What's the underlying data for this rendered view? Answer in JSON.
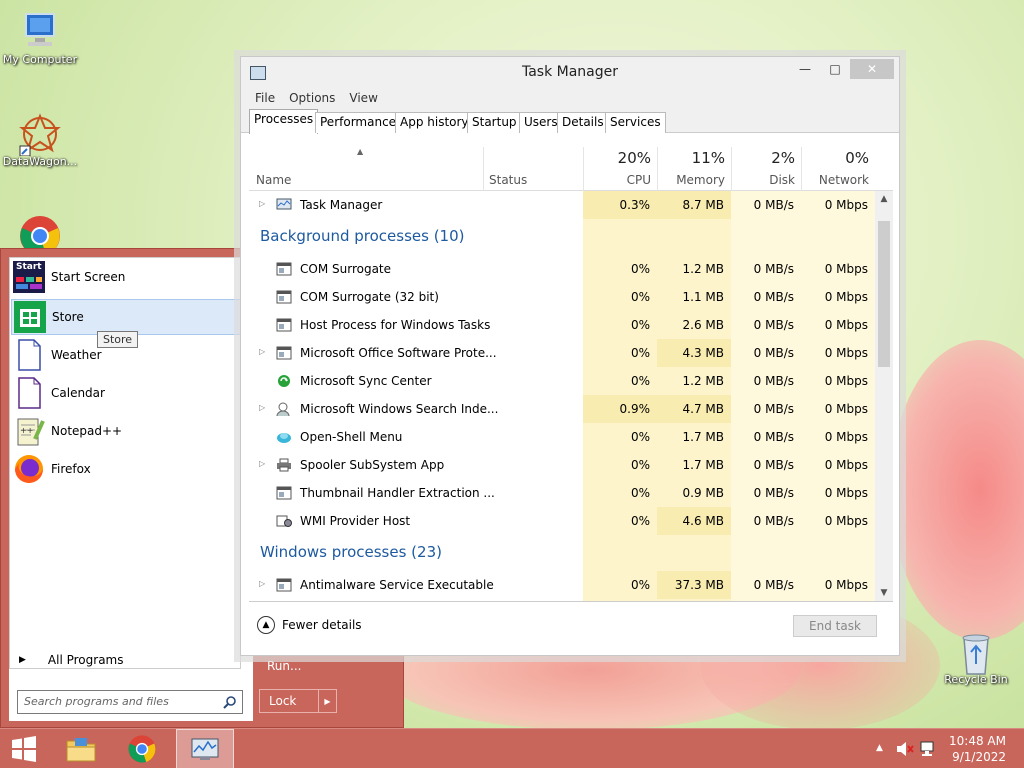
{
  "desktop": {
    "icons": [
      {
        "label": "My Computer"
      },
      {
        "label": "DataWagon..."
      },
      {
        "label": "Recycle Bin"
      }
    ]
  },
  "start_menu": {
    "items": [
      {
        "label": "Start Screen",
        "icon": "start-screen-icon"
      },
      {
        "label": "Store",
        "icon": "store-icon"
      },
      {
        "label": "Weather",
        "icon": "document-icon"
      },
      {
        "label": "Calendar",
        "icon": "document-icon"
      },
      {
        "label": "Notepad++",
        "icon": "notepad-plus-icon"
      },
      {
        "label": "Firefox",
        "icon": "firefox-icon"
      }
    ],
    "start_tile_text": "Start",
    "tooltip": "Store",
    "all_programs": "All Programs",
    "search_placeholder": "Search programs and files",
    "run": "Run...",
    "lock": "Lock"
  },
  "task_manager": {
    "title": "Task Manager",
    "menu": [
      "File",
      "Options",
      "View"
    ],
    "tabs": [
      "Processes",
      "Performance",
      "App history",
      "Startup",
      "Users",
      "Details",
      "Services"
    ],
    "active_tab": "Processes",
    "columns": {
      "name": "Name",
      "status": "Status",
      "cpu": {
        "pct": "20%",
        "label": "CPU"
      },
      "memory": {
        "pct": "11%",
        "label": "Memory"
      },
      "disk": {
        "pct": "2%",
        "label": "Disk"
      },
      "network": {
        "pct": "0%",
        "label": "Network"
      }
    },
    "apps": [
      {
        "name": "Task Manager",
        "cpu": "0.3%",
        "memory": "8.7 MB",
        "disk": "0 MB/s",
        "network": "0 Mbps",
        "expandable": true,
        "icon": "task-manager-icon"
      }
    ],
    "background_group": "Background processes (10)",
    "background": [
      {
        "name": "COM Surrogate",
        "cpu": "0%",
        "memory": "1.2 MB",
        "disk": "0 MB/s",
        "network": "0 Mbps",
        "expandable": false,
        "icon": "window-icon"
      },
      {
        "name": "COM Surrogate (32 bit)",
        "cpu": "0%",
        "memory": "1.1 MB",
        "disk": "0 MB/s",
        "network": "0 Mbps",
        "expandable": false,
        "icon": "window-icon"
      },
      {
        "name": "Host Process for Windows Tasks",
        "cpu": "0%",
        "memory": "2.6 MB",
        "disk": "0 MB/s",
        "network": "0 Mbps",
        "expandable": false,
        "icon": "window-icon"
      },
      {
        "name": "Microsoft Office Software Prote...",
        "cpu": "0%",
        "memory": "4.3 MB",
        "disk": "0 MB/s",
        "network": "0 Mbps",
        "expandable": true,
        "icon": "window-icon"
      },
      {
        "name": "Microsoft Sync Center",
        "cpu": "0%",
        "memory": "1.2 MB",
        "disk": "0 MB/s",
        "network": "0 Mbps",
        "expandable": false,
        "icon": "sync-icon"
      },
      {
        "name": "Microsoft Windows Search Inde...",
        "cpu": "0.9%",
        "memory": "4.7 MB",
        "disk": "0 MB/s",
        "network": "0 Mbps",
        "expandable": true,
        "icon": "search-user-icon"
      },
      {
        "name": "Open-Shell Menu",
        "cpu": "0%",
        "memory": "1.7 MB",
        "disk": "0 MB/s",
        "network": "0 Mbps",
        "expandable": false,
        "icon": "shell-icon"
      },
      {
        "name": "Spooler SubSystem App",
        "cpu": "0%",
        "memory": "1.7 MB",
        "disk": "0 MB/s",
        "network": "0 Mbps",
        "expandable": true,
        "icon": "printer-icon"
      },
      {
        "name": "Thumbnail Handler Extraction ...",
        "cpu": "0%",
        "memory": "0.9 MB",
        "disk": "0 MB/s",
        "network": "0 Mbps",
        "expandable": false,
        "icon": "window-icon"
      },
      {
        "name": "WMI Provider Host",
        "cpu": "0%",
        "memory": "4.6 MB",
        "disk": "0 MB/s",
        "network": "0 Mbps",
        "expandable": false,
        "icon": "wmi-icon"
      }
    ],
    "windows_group": "Windows processes (23)",
    "windows": [
      {
        "name": "Antimalware Service Executable",
        "cpu": "0%",
        "memory": "37.3 MB",
        "disk": "0 MB/s",
        "network": "0 Mbps",
        "expandable": true,
        "icon": "window-icon"
      }
    ],
    "fewer_details": "Fewer details",
    "end_task": "End task"
  },
  "taskbar": {
    "time": "10:48 AM",
    "date": "9/1/2022"
  },
  "colors": {
    "accent": "#c9665c",
    "group_text": "#1e5aa0",
    "cpu_high": "#f9ecb0",
    "cpu_low": "#fdf6d6"
  }
}
